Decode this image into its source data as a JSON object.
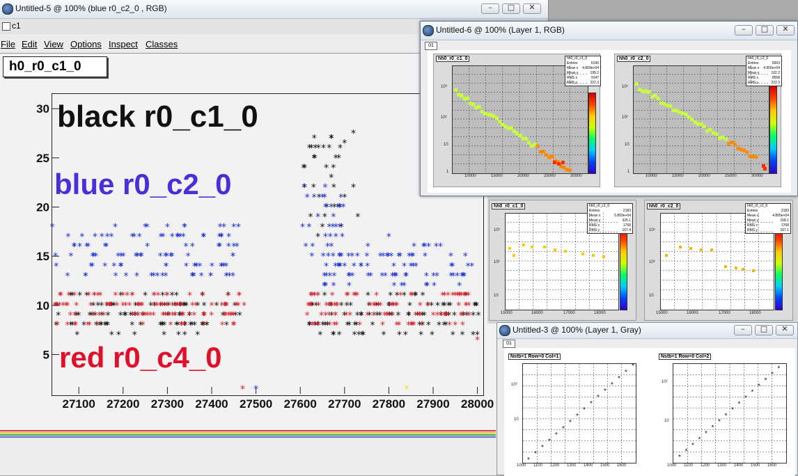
{
  "main_window": {
    "title": "Untitled-5 @ 100% (blue r0_c2_0 , RGB)",
    "canvas_tab": "c1",
    "menu": [
      "File",
      "Edit",
      "View",
      "Options",
      "Inspect",
      "Classes"
    ],
    "histogram_label": "h0_r0_c1_0",
    "legend": {
      "black": "black r0_c1_0",
      "blue": "blue r0_c2_0",
      "red": "red r0_c4_0"
    },
    "colors": {
      "black": "#111111",
      "blue": "#1a2fd6",
      "red": "#e0202a",
      "blue_text": "#4a2fd8",
      "red_text": "#e0102a"
    }
  },
  "window_rgb": {
    "title": "Untitled-6 @ 100% (Layer 1, RGB)",
    "tab": "01",
    "panels": [
      {
        "label": "hh0_r0_c1_0",
        "stats_title": "hh0_r0_c1_0",
        "stats": [
          [
            "Entries",
            "6196"
          ],
          [
            "Mean x",
            "4.809e+04"
          ],
          [
            "Mean y",
            "199.2"
          ],
          [
            "RMS x",
            "9147"
          ],
          [
            "RMS y",
            "222.3"
          ]
        ],
        "xticks": [
          "10000",
          "15000",
          "20000",
          "25000",
          "30000"
        ],
        "yticks": [
          "10³",
          "10²",
          "10",
          "1"
        ]
      },
      {
        "label": "hh0_r0_c2_0",
        "stats_title": "hh0_r0_c2_0",
        "stats": [
          [
            "Entries",
            "6003"
          ],
          [
            "Mean x",
            "4.955e+04"
          ],
          [
            "Mean y",
            "102.2"
          ],
          [
            "RMS x",
            "8558"
          ],
          [
            "RMS y",
            "222.3"
          ]
        ],
        "xticks": [
          "10000",
          "15000",
          "20000",
          "25000",
          "30000"
        ],
        "yticks": [
          "10³",
          "10²",
          "10",
          "1"
        ]
      }
    ]
  },
  "window_middle": {
    "panels": [
      {
        "label": "hh0_r0_c1_0",
        "stats_title": "hh0_r0_c1_0",
        "stats": [
          [
            "Entries",
            "2183"
          ],
          [
            "Mean x",
            "5.893e+04"
          ],
          [
            "Mean y",
            "325.1"
          ],
          [
            "RMS x",
            "1768"
          ],
          [
            "RMS y",
            "167.4"
          ]
        ],
        "xticks": [
          "15000",
          "15500",
          "16000",
          "16500",
          "17000",
          "17500",
          "18000"
        ],
        "yticks": [
          "10³",
          "10²",
          "10"
        ]
      },
      {
        "label": "hh0_r0_c2_0",
        "stats_title": "hh0_r0_c2_0",
        "stats": [
          [
            "Entries",
            "2183"
          ],
          [
            "Mean x",
            "4.895e+04"
          ],
          [
            "Mean y",
            "158.1"
          ],
          [
            "RMS x",
            "1768"
          ],
          [
            "RMS y",
            "167.1"
          ]
        ],
        "xticks": [
          "15000",
          "15500",
          "16000",
          "16500",
          "17000",
          "17500",
          "18000"
        ],
        "yticks": [
          "10³",
          "10²",
          "10"
        ]
      }
    ]
  },
  "window_gray": {
    "title": "Untitled-3 @ 100% (Layer 1, Gray)",
    "tab": "01",
    "panels": [
      {
        "label": "Nstb=1 Row=0 Col=1",
        "xticks": [
          "1000",
          "1100",
          "1200",
          "1300",
          "1400",
          "1500",
          "1600"
        ],
        "yticks": [
          "10²",
          "10"
        ]
      },
      {
        "label": "Nstb=1 Row=0 Col=2",
        "xticks": [
          "1000",
          "1100",
          "1200",
          "1300",
          "1400",
          "1500",
          "1600"
        ],
        "yticks": [
          "10²",
          "10"
        ]
      }
    ]
  },
  "window_buttons": {
    "minimize": "–",
    "maximize": "□",
    "close": "✕"
  },
  "chart_data": {
    "type": "scatter",
    "title": "",
    "legend_placement": "top-left",
    "xlim": [
      27040,
      28010
    ],
    "ylim": [
      1,
      31.5
    ],
    "xticks": [
      27100,
      27200,
      27300,
      27400,
      27500,
      27600,
      27700,
      27800,
      27900,
      28000
    ],
    "yticks": [
      5,
      10,
      15,
      20,
      25,
      30
    ],
    "x_tick_labels": [
      "27100",
      "27200",
      "27300",
      "27400",
      "27500",
      "27600",
      "27700",
      "27800",
      "27900",
      "28000"
    ],
    "y_tick_labels": [
      "5",
      "10",
      "15",
      "20",
      "25",
      "30"
    ],
    "marker": "*",
    "series": [
      {
        "color": "black",
        "clusters": [
          {
            "x": [
              27045,
              27465
            ],
            "y": [
              7,
              11
            ]
          },
          {
            "x": [
              27605,
              27695
            ],
            "y": [
              18,
              27
            ]
          },
          {
            "x": [
              27615,
              28005
            ],
            "y": [
              7,
              11
            ]
          }
        ],
        "sample_points": [
          [
            27720,
            27.5
          ],
          [
            27700,
            26.5
          ],
          [
            27690,
            26
          ],
          [
            27680,
            25
          ],
          [
            27610,
            24
          ],
          [
            27670,
            23
          ],
          [
            27630,
            22
          ],
          [
            27720,
            22
          ],
          [
            27700,
            21
          ],
          [
            27660,
            20
          ],
          [
            27730,
            19
          ],
          [
            27650,
            18
          ],
          [
            27640,
            17
          ],
          [
            28000,
            7
          ],
          [
            27270,
            11
          ]
        ]
      },
      {
        "color": "blue",
        "clusters": [
          {
            "x": [
              27045,
              27465
            ],
            "y": [
              12.5,
              18
            ]
          },
          {
            "x": [
              27605,
              27700
            ],
            "y": [
              15,
              22
            ]
          },
          {
            "x": [
              27650,
              27995
            ],
            "y": [
              12,
              16
            ]
          }
        ],
        "sample_points": [
          [
            27040,
            18
          ],
          [
            27250,
            18
          ],
          [
            27300,
            18
          ],
          [
            27450,
            18
          ],
          [
            27610,
            22
          ],
          [
            27650,
            21
          ],
          [
            27690,
            20
          ],
          [
            27640,
            19
          ],
          [
            27620,
            18
          ],
          [
            27800,
            17
          ],
          [
            27890,
            16
          ],
          [
            27500,
            1.5
          ]
        ]
      },
      {
        "color": "red",
        "clusters": [
          {
            "x": [
              27045,
              27475
            ],
            "y": [
              8,
              11
            ]
          },
          {
            "x": [
              27610,
              27995
            ],
            "y": [
              8,
              11.5
            ]
          }
        ],
        "sample_points": [
          [
            27470,
            1.5
          ],
          [
            27270,
            11
          ],
          [
            27380,
            11
          ],
          [
            27950,
            11
          ],
          [
            27640,
            11
          ],
          [
            27090,
            11
          ],
          [
            27200,
            11
          ],
          [
            28000,
            6.5
          ]
        ]
      },
      {
        "color": "yellow",
        "sample_points": [
          [
            27840,
            1.5
          ]
        ]
      }
    ]
  }
}
